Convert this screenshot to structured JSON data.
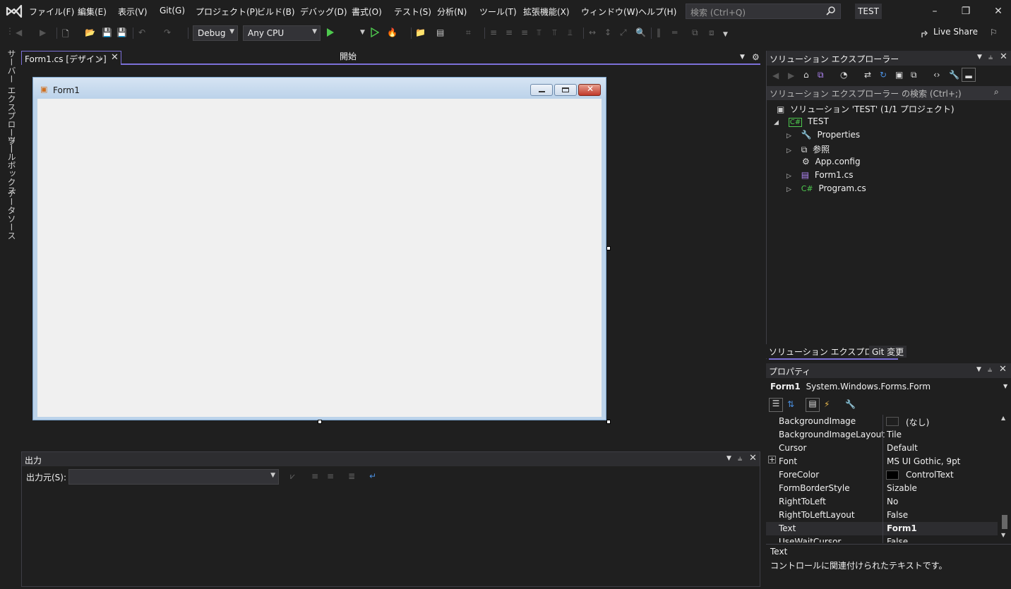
{
  "menu": {
    "items": [
      "ファイル(F)",
      "編集(E)",
      "表示(V)",
      "Git(G)",
      "プロジェクト(P)",
      "ビルド(B)",
      "デバッグ(D)",
      "書式(O)",
      "テスト(S)",
      "分析(N)",
      "ツール(T)",
      "拡張機能(X)",
      "ウィンドウ(W)",
      "ヘルプ(H)"
    ],
    "search_placeholder": "検索 (Ctrl+Q)",
    "solution_badge": "TEST"
  },
  "toolbar": {
    "config": "Debug",
    "platform": "Any CPU",
    "start_label": "開始",
    "liveshare_label": "Live Share"
  },
  "left_strip": {
    "tabs": [
      "サーバー エクスプローラー",
      "ツールボックス",
      "データソース"
    ]
  },
  "document": {
    "tab_label": "Form1.cs [デザイン]"
  },
  "designer": {
    "form_title": "Form1"
  },
  "output": {
    "title": "出力",
    "source_label": "出力元(S):",
    "source_value": ""
  },
  "solution_explorer": {
    "title": "ソリューション エクスプローラー",
    "search_placeholder": "ソリューション エクスプローラー の検索 (Ctrl+;)",
    "solution_node": "ソリューション 'TEST' (1/1 プロジェクト)",
    "project_node": "TEST",
    "items": [
      {
        "label": "Properties",
        "expandable": true,
        "icon": "wrench-icon"
      },
      {
        "label": "参照",
        "expandable": true,
        "icon": "references-icon"
      },
      {
        "label": "App.config",
        "expandable": false,
        "icon": "config-icon"
      },
      {
        "label": "Form1.cs",
        "expandable": true,
        "icon": "form-icon"
      },
      {
        "label": "Program.cs",
        "expandable": true,
        "icon": "csharp-icon"
      }
    ],
    "bottom_tabs": [
      "ソリューション エクスプローラー",
      "Git 変更"
    ]
  },
  "properties": {
    "title": "プロパティ",
    "object_name": "Form1",
    "object_type": "System.Windows.Forms.Form",
    "rows": [
      {
        "name": "BackgroundImage",
        "value": "(なし)",
        "swatch": "#1f1f1f"
      },
      {
        "name": "BackgroundImageLayout",
        "value": "Tile"
      },
      {
        "name": "Cursor",
        "value": "Default"
      },
      {
        "name": "Font",
        "value": "MS UI Gothic, 9pt",
        "expandable": true
      },
      {
        "name": "ForeColor",
        "value": "ControlText",
        "swatch": "#000000"
      },
      {
        "name": "FormBorderStyle",
        "value": "Sizable"
      },
      {
        "name": "RightToLeft",
        "value": "No"
      },
      {
        "name": "RightToLeftLayout",
        "value": "False"
      },
      {
        "name": "Text",
        "value": "Form1",
        "bold": true
      },
      {
        "name": "UseWaitCursor",
        "value": "False"
      }
    ],
    "description_title": "Text",
    "description_text": "コントロールに関連付けられたテキストです。"
  },
  "colors": {
    "accent": "#7c70d8",
    "panel_bg": "#1f1f1f",
    "header_bg": "#2d2d30"
  }
}
